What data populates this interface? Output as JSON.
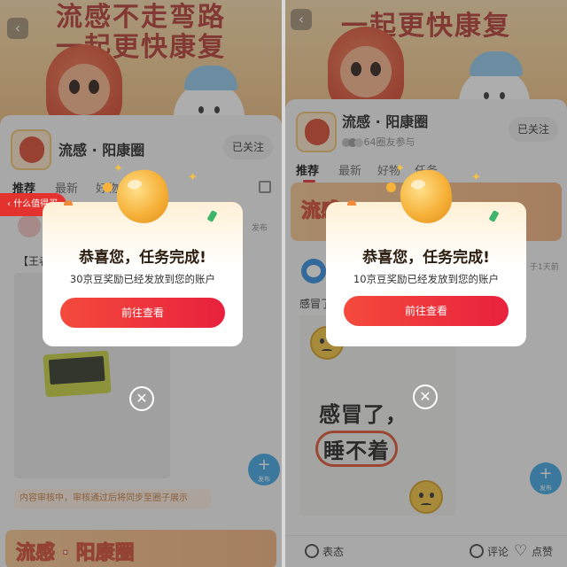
{
  "screens": [
    {
      "banner_headline_top": "流感不走弯路",
      "banner_headline_bottom": "一起更快康复",
      "circle_name": "流感 · 阳康圈",
      "follow_label": "已关注",
      "tabs": [
        "推荐",
        "最新",
        "好物"
      ],
      "side_pill": "什么值得买",
      "post_title_fragment": "【王者",
      "publish_label_fragment": "发布",
      "notice_text": "内容审核中，审核通过后将同步至圈子展示",
      "bottom_promo": "流感 · 阳康圈",
      "fab_label": "发布",
      "modal": {
        "title": "恭喜您，任务完成!",
        "message": "30京豆奖励已经发放到您的账户",
        "cta": "前往查看"
      }
    },
    {
      "banner_headline_bottom": "一起更快康复",
      "circle_name": "流感 · 阳康圈",
      "members_text": "64圈友参与",
      "follow_label": "已关注",
      "tabs": [
        "推荐",
        "最新",
        "好物",
        "任务"
      ],
      "promo_text": "流感",
      "post_time_fragment": "于1天前",
      "post_text": "感冒了",
      "post_card_line1": "感冒了，",
      "post_card_line2": "睡不着",
      "fab_label": "发布",
      "bottom_bar": {
        "emoji": "表态",
        "comment": "评论",
        "like": "点赞"
      },
      "modal": {
        "title": "恭喜您，任务完成!",
        "message": "10京豆奖励已经发放到您的账户",
        "cta": "前往查看"
      }
    }
  ]
}
